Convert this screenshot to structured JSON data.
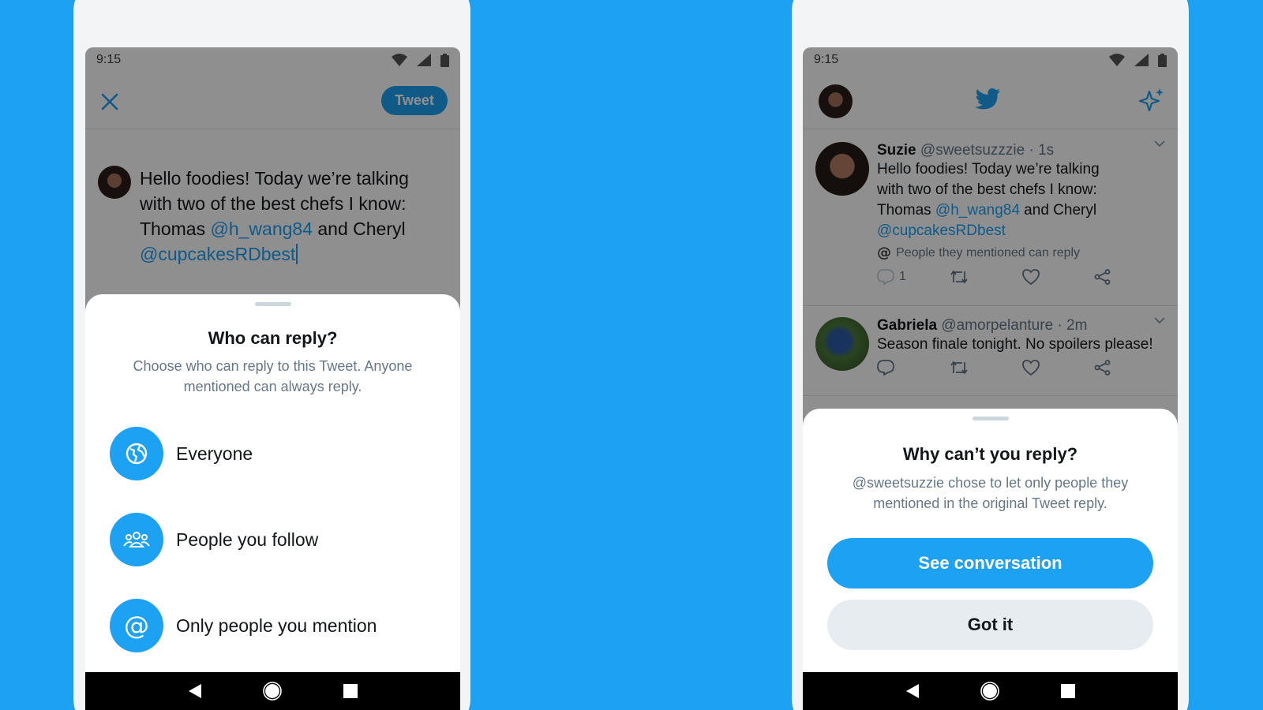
{
  "colors": {
    "brand": "#1da1f2",
    "background": "#1da1f2",
    "text": "#14171a",
    "muted": "#657786"
  },
  "left": {
    "status": {
      "time": "9:15"
    },
    "compose": {
      "tweet_button": "Tweet",
      "text_lines": [
        {
          "plain": "Hello foodies! Today we’re talking"
        },
        {
          "plain": "with two of the best chefs I know:"
        },
        {
          "plain": "Thomas ",
          "mention": "@h_wang84",
          "after": " and Cheryl"
        },
        {
          "mention": "@cupcakesRDbest"
        }
      ]
    },
    "sheet": {
      "title": "Who can reply?",
      "description": "Choose who can reply to this Tweet. Anyone mentioned can always reply.",
      "options": [
        {
          "label": "Everyone",
          "icon": "globe-icon"
        },
        {
          "label": "People you follow",
          "icon": "people-icon"
        },
        {
          "label": "Only people you mention",
          "icon": "at-sign-icon"
        }
      ]
    }
  },
  "right": {
    "status": {
      "time": "9:15"
    },
    "tweets": [
      {
        "name": "Suzie",
        "handle": "@sweetsuzzzie",
        "time": "· 1s",
        "lines": [
          {
            "plain": "Hello foodies! Today we’re talking"
          },
          {
            "plain": "with two of the best chefs I know:"
          },
          {
            "plain": "Thomas ",
            "mention": "@h_wang84",
            "after": " and Cheryl"
          },
          {
            "mention": "@cupcakesRDbest"
          }
        ],
        "note": "People they mentioned can reply",
        "reply_count": "1"
      },
      {
        "name": "Gabriela",
        "handle": "@amorpelanture",
        "time": "· 2m",
        "lines": [
          {
            "plain": "Season finale tonight. No spoilers please!"
          }
        ]
      }
    ],
    "sheet": {
      "title": "Why can’t you reply?",
      "description": "@sweetsuzzie chose to let only people they mentioned in the original Tweet reply.",
      "primary_button": "See conversation",
      "secondary_button": "Got it"
    }
  }
}
